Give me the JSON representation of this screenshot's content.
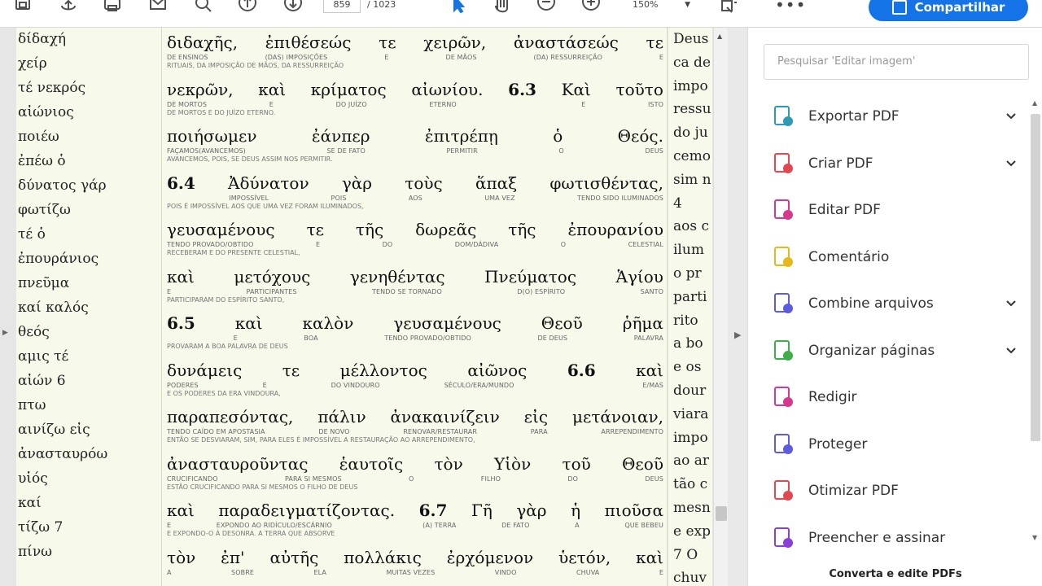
{
  "toolbar": {
    "page_current": "859",
    "page_total": "/ 1023",
    "zoom": "150%",
    "share_label": "Compartilhar",
    "icons": [
      "save-icon",
      "upload-icon",
      "print-icon",
      "email-icon",
      "search-icon",
      "page-up-icon",
      "page-down-icon",
      "select-cursor-icon",
      "hand-icon",
      "zoom-out-icon",
      "zoom-in-icon",
      "fit-page-icon",
      "more-icon",
      "share-icon"
    ]
  },
  "left_column": [
    "δίδαχή",
    "χείρ",
    "τέ νεκρός",
    "αἰώνιος",
    "ποιέω",
    "ἐπέω ὁ",
    "δύνατος γάρ",
    "φωτίζω",
    "τέ ὁ",
    "ἐπουράνιος",
    "πνεῦμα",
    "καί καλός",
    "θεός",
    "αμις τέ",
    "αἰών 6",
    "πτω",
    "αινίζω εἰς",
    "ἀνασταυρόω",
    "υἱός",
    "καί",
    "τίζω 7",
    "πίνω"
  ],
  "main_lines": [
    {
      "greek": [
        "διδαχῆς,",
        "ἐπιθέσεώς",
        "τε",
        "χειρῶν,",
        "ἀναστάσεώς",
        "τε"
      ],
      "gloss": [
        "DE ENSINOS",
        "(DAS) IMPOSIÇÕES",
        "E",
        "DE MÃOS",
        "(DA) RESSURREIÇÃO",
        "E"
      ],
      "note": "RITUAIS,        DA IMPOSIÇÃO DE MÃOS,        DA RESSURREIÇÃO"
    },
    {
      "greek": [
        "νεκρῶν,",
        "καὶ",
        "κρίματος",
        "αἰωνίου.",
        "6.3",
        "Καὶ",
        "τοῦτο"
      ],
      "gloss": [
        "DE MORTOS",
        "E",
        "DO JUÍZO",
        "ETERNO",
        "",
        "E",
        "ISTO"
      ],
      "note": "DE MORTOS        E        DO JUÍZO        ETERNO."
    },
    {
      "greek": [
        "ποιήσωμεν",
        "ἐάνπερ",
        "ἐπιτρέπῃ",
        "ὁ",
        "Θεός."
      ],
      "gloss": [
        "FAÇAMOS(AVANCEMOS)",
        "SE DE FATO",
        "PERMITIR",
        "O",
        "DEUS"
      ],
      "note": "AVANCEMOS, POIS, SE DEUS ASSIM NOS PERMITIR."
    },
    {
      "greek": [
        "6.4",
        "Ἀδύνατον",
        "γὰρ",
        "τοὺς",
        "ἅπαξ",
        "φωτισθέντας,"
      ],
      "gloss": [
        "",
        "IMPOSSÍVEL",
        "POIS",
        "AOS",
        "UMA VEZ",
        "TENDO SIDO ILUMINADOS"
      ],
      "note": "POIS É IMPOSSÍVEL        AOS        QUE UMA VEZ FORAM ILUMINADOS,"
    },
    {
      "greek": [
        "γευσαμένους",
        "τε",
        "τῆς",
        "δωρεᾶς",
        "τῆς",
        "ἐπουρανίου"
      ],
      "gloss": [
        "TENDO PROVADO/OBTIDO",
        "E",
        "DO",
        "DOM/DÁDIVA",
        "O",
        "CELESTIAL"
      ],
      "note": "RECEBERAM        E        DO        PRESENTE        CELESTIAL,"
    },
    {
      "greek": [
        "καὶ",
        "μετόχους",
        "γενηθέντας",
        "Πνεύματος",
        "Ἁγίου"
      ],
      "gloss": [
        "E",
        "PARTICIPANTES",
        "TENDO SE TORNADO",
        "D(O) ESPÍRITO",
        "SANTO"
      ],
      "note": "PARTICIPARAM        DO ESPÍRITO        SANTO,"
    },
    {
      "greek": [
        "6.5",
        "καὶ",
        "καλὸν",
        "γευσαμένους",
        "Θεοῦ",
        "ῥῆμα"
      ],
      "gloss": [
        "",
        "E",
        "BOA",
        "TENDO PROVADO/OBTIDO",
        "DE DEUS",
        "PALAVRA"
      ],
      "note": "PROVARAM A BOA PALAVRA DE DEUS"
    },
    {
      "greek": [
        "δυνάμεις",
        "τε",
        "μέλλοντος",
        "αἰῶνος",
        "6.6",
        "καὶ"
      ],
      "gloss": [
        "PODERES",
        "E",
        "DO VINDOURO",
        "SÉCULO/ERA/MUNDO",
        "",
        "E/MAS"
      ],
      "note": "E OS PODERES        DA ERA VINDOURA,"
    },
    {
      "greek": [
        "παραπεσόντας,",
        "πάλιν",
        "ἀνακαινίζειν",
        "εἰς",
        "μετάνοιαν,"
      ],
      "gloss": [
        "TENDO CAÍDO EM APOSTASIA",
        "DE NOVO",
        "RENOVAR/RESTAURAR",
        "PARA",
        "ARREPENDIMENTO"
      ],
      "note": "ENTÃO SE DESVIARAM, SIM, PARA ELES É IMPOSSÍVEL A RESTAURAÇÃO        AO        ARREPENDIMENTO,"
    },
    {
      "greek": [
        "ἀνασταυροῦντας",
        "ἑαυτοῖς",
        "τὸν",
        "Υἱὸν",
        "τοῦ",
        "Θεοῦ"
      ],
      "gloss": [
        "CRUCIFICANDO",
        "PARA SI MESMOS",
        "O",
        "FILHO",
        "DO",
        "DEUS"
      ],
      "note": "ESTÃO CRUCIFICANDO        PARA SI MESMOS        O        FILHO        DE DEUS"
    },
    {
      "greek": [
        "καὶ",
        "παραδειγματίζοντας.",
        "6.7",
        "Γῆ",
        "γὰρ",
        "ἡ",
        "πιοῦσα"
      ],
      "gloss": [
        "E",
        "EXPONDO AO RIDÍCULO/ESCÁRNIO",
        "",
        "(A) TERRA",
        "DE FATO",
        "A",
        "QUE BEBEU"
      ],
      "note": "E        EXPONDO-O À DESONRA.        A TERRA        QUE ABSORVE"
    },
    {
      "greek": [
        "τὸν",
        "ἐπ'",
        "αὐτῆς",
        "πολλάκις",
        "ἐρχόμενον",
        "ὑετόν,",
        "καὶ"
      ],
      "gloss": [
        "A",
        "SOBRE",
        "ELA",
        "MUITAS VEZES",
        "VINDO",
        "CHUVA",
        "E"
      ],
      "note": ""
    }
  ],
  "right_column": [
    "Deus",
    "ca de",
    "impo",
    "ressu",
    "do ju",
    "cemo",
    "sim n",
    "4",
    "aos c",
    "ilum",
    "o pr",
    "parti",
    "rito",
    "a bo",
    "e os",
    "dour",
    "viara",
    "impo",
    "ao ar",
    "tão c",
    "mesn",
    "e exp",
    "7 O",
    "chuv"
  ],
  "panel": {
    "search_placeholder": "Pesquisar 'Editar imagem'",
    "tools": [
      {
        "label": "Exportar PDF",
        "icon": "export-pdf-icon",
        "color": "#2d9ab5",
        "chevron": true
      },
      {
        "label": "Criar PDF",
        "icon": "create-pdf-icon",
        "color": "#e34850",
        "chevron": true
      },
      {
        "label": "Editar PDF",
        "icon": "edit-pdf-icon",
        "color": "#d83790",
        "chevron": false
      },
      {
        "label": "Comentário",
        "icon": "comment-icon",
        "color": "#e8b81a",
        "chevron": false
      },
      {
        "label": "Combine arquivos",
        "icon": "combine-files-icon",
        "color": "#5c5ce0",
        "chevron": true
      },
      {
        "label": "Organizar páginas",
        "icon": "organize-pages-icon",
        "color": "#3fae49",
        "chevron": true
      },
      {
        "label": "Redigir",
        "icon": "redact-icon",
        "color": "#d83790",
        "chevron": false
      },
      {
        "label": "Proteger",
        "icon": "protect-icon",
        "color": "#5c5ce0",
        "chevron": false
      },
      {
        "label": "Otimizar PDF",
        "icon": "optimize-pdf-icon",
        "color": "#e34850",
        "chevron": false
      },
      {
        "label": "Preencher e assinar",
        "icon": "fill-sign-icon",
        "color": "#8c3fd6",
        "chevron": false
      }
    ],
    "footer": "Converta e edite PDFs"
  }
}
